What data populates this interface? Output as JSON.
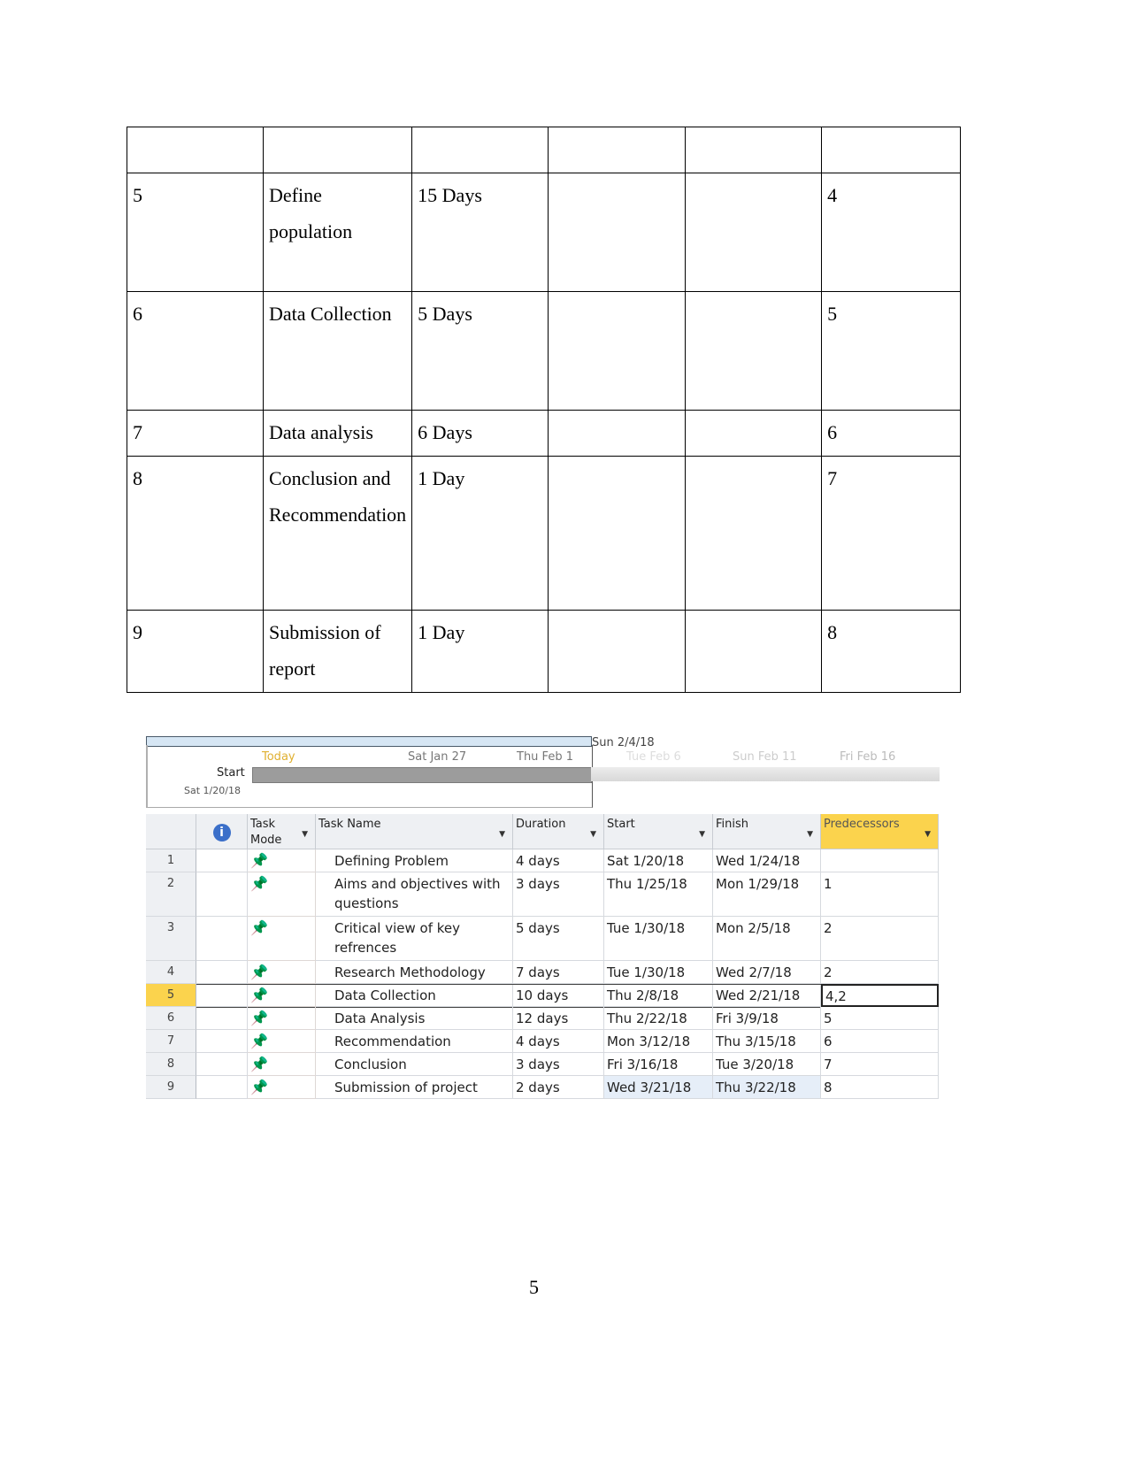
{
  "doc_table": {
    "rows": [
      [
        "",
        "",
        "",
        "",
        "",
        ""
      ],
      [
        "5",
        "Define population",
        "15  Days",
        "",
        "",
        "4"
      ],
      [
        "6",
        "Data Collection",
        "5  Days",
        "",
        "",
        "5"
      ],
      [
        "7",
        "Data analysis",
        "6  Days",
        "",
        "",
        "6"
      ],
      [
        "8",
        "Conclusion and Recommendation",
        "1 Day",
        "",
        "",
        "7"
      ],
      [
        "9",
        "Submission  of report",
        "1 Day",
        "",
        "",
        "8"
      ]
    ]
  },
  "project_screenshot": {
    "timeline": {
      "marker_date": "Sun 2/4/18",
      "today_label": "Today",
      "ticks": [
        "Sat Jan 27",
        "Thu Feb 1",
        "Tue Feb 6",
        "Sun Feb 11",
        "Fri Feb 16"
      ],
      "start_label": "Start",
      "start_date": "Sat 1/20/18"
    },
    "columns": [
      "Task Mode",
      "Task Name",
      "Duration",
      "Start",
      "Finish",
      "Predecessors"
    ],
    "selected_row": "5",
    "highlight_color": "#fbd34d",
    "tasks": [
      {
        "id": "1",
        "name": "Defining Problem",
        "duration": "4 days",
        "start": "Sat 1/20/18",
        "finish": "Wed 1/24/18",
        "pred": ""
      },
      {
        "id": "2",
        "name": "Aims and objectives with questions",
        "duration": "3 days",
        "start": "Thu 1/25/18",
        "finish": "Mon 1/29/18",
        "pred": "1"
      },
      {
        "id": "3",
        "name": "Critical view of key refrences",
        "duration": "5 days",
        "start": "Tue 1/30/18",
        "finish": "Mon 2/5/18",
        "pred": "2"
      },
      {
        "id": "4",
        "name": "Research Methodology",
        "duration": "7 days",
        "start": "Tue 1/30/18",
        "finish": "Wed 2/7/18",
        "pred": "2"
      },
      {
        "id": "5",
        "name": "Data Collection",
        "duration": "10 days",
        "start": "Thu 2/8/18",
        "finish": "Wed 2/21/18",
        "pred": "4,2"
      },
      {
        "id": "6",
        "name": "Data Analysis",
        "duration": "12 days",
        "start": "Thu 2/22/18",
        "finish": "Fri 3/9/18",
        "pred": "5"
      },
      {
        "id": "7",
        "name": "Recommendation",
        "duration": "4 days",
        "start": "Mon 3/12/18",
        "finish": "Thu 3/15/18",
        "pred": "6"
      },
      {
        "id": "8",
        "name": "Conclusion",
        "duration": "3 days",
        "start": "Fri 3/16/18",
        "finish": "Tue 3/20/18",
        "pred": "7"
      },
      {
        "id": "9",
        "name": "Submission of project",
        "duration": "2 days",
        "start": "Wed 3/21/18",
        "finish": "Thu 3/22/18",
        "pred": "8"
      }
    ]
  },
  "page_number": "5"
}
